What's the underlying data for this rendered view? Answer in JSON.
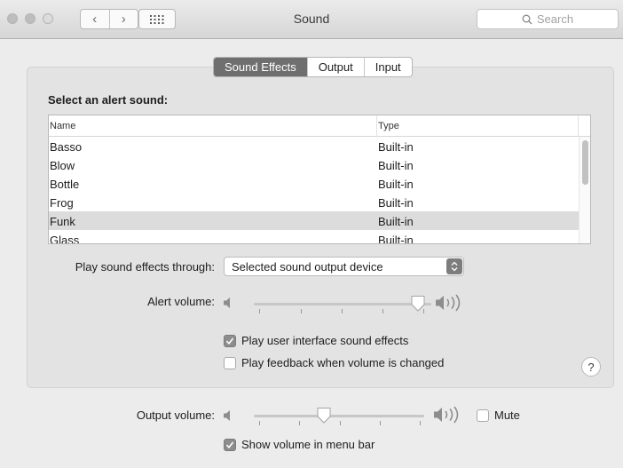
{
  "window": {
    "title": "Sound"
  },
  "search": {
    "placeholder": "Search"
  },
  "tabs": [
    {
      "label": "Sound Effects",
      "active": true
    },
    {
      "label": "Output",
      "active": false
    },
    {
      "label": "Input",
      "active": false
    }
  ],
  "alert_heading": "Select an alert sound:",
  "table": {
    "columns": [
      "Name",
      "Type"
    ],
    "rows": [
      {
        "name": "Basso",
        "type": "Built-in"
      },
      {
        "name": "Blow",
        "type": "Built-in"
      },
      {
        "name": "Bottle",
        "type": "Built-in"
      },
      {
        "name": "Frog",
        "type": "Built-in"
      },
      {
        "name": "Funk",
        "type": "Built-in",
        "selected": true
      },
      {
        "name": "Glass",
        "type": "Built-in"
      }
    ]
  },
  "play_through": {
    "label": "Play sound effects through:",
    "value": "Selected sound output device"
  },
  "alert_volume": {
    "label": "Alert volume:",
    "level": 0.9
  },
  "ui_sound_effects": {
    "label": "Play user interface sound effects",
    "checked": true
  },
  "feedback": {
    "label": "Play feedback when volume is changed",
    "checked": false
  },
  "help": {
    "label": "?"
  },
  "output_volume": {
    "label": "Output volume:",
    "level": 0.38
  },
  "mute": {
    "label": "Mute",
    "checked": false
  },
  "menu_bar": {
    "label": "Show volume in menu bar",
    "checked": true
  }
}
